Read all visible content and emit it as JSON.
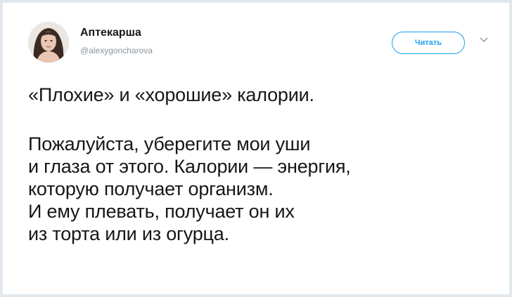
{
  "author": {
    "display_name": "Аптекарша",
    "handle": "@alexygoncharova",
    "avatar_icon": "user-avatar-photo"
  },
  "actions": {
    "follow_label": "Читать",
    "menu_icon": "chevron-down-icon"
  },
  "tweet": {
    "title_line": "«Плохие» и «хорошие» калории.",
    "body_lines": [
      "Пожалуйста, уберегите мои уши",
      "и глаза от этого. Калории — энергия,",
      "которую получает организм.",
      "И ему плевать, получает он их",
      "из торта или из огурца."
    ]
  },
  "colors": {
    "accent": "#1da1f2",
    "text": "#14171a",
    "muted": "#8a949e",
    "border": "#e1e8ed"
  }
}
